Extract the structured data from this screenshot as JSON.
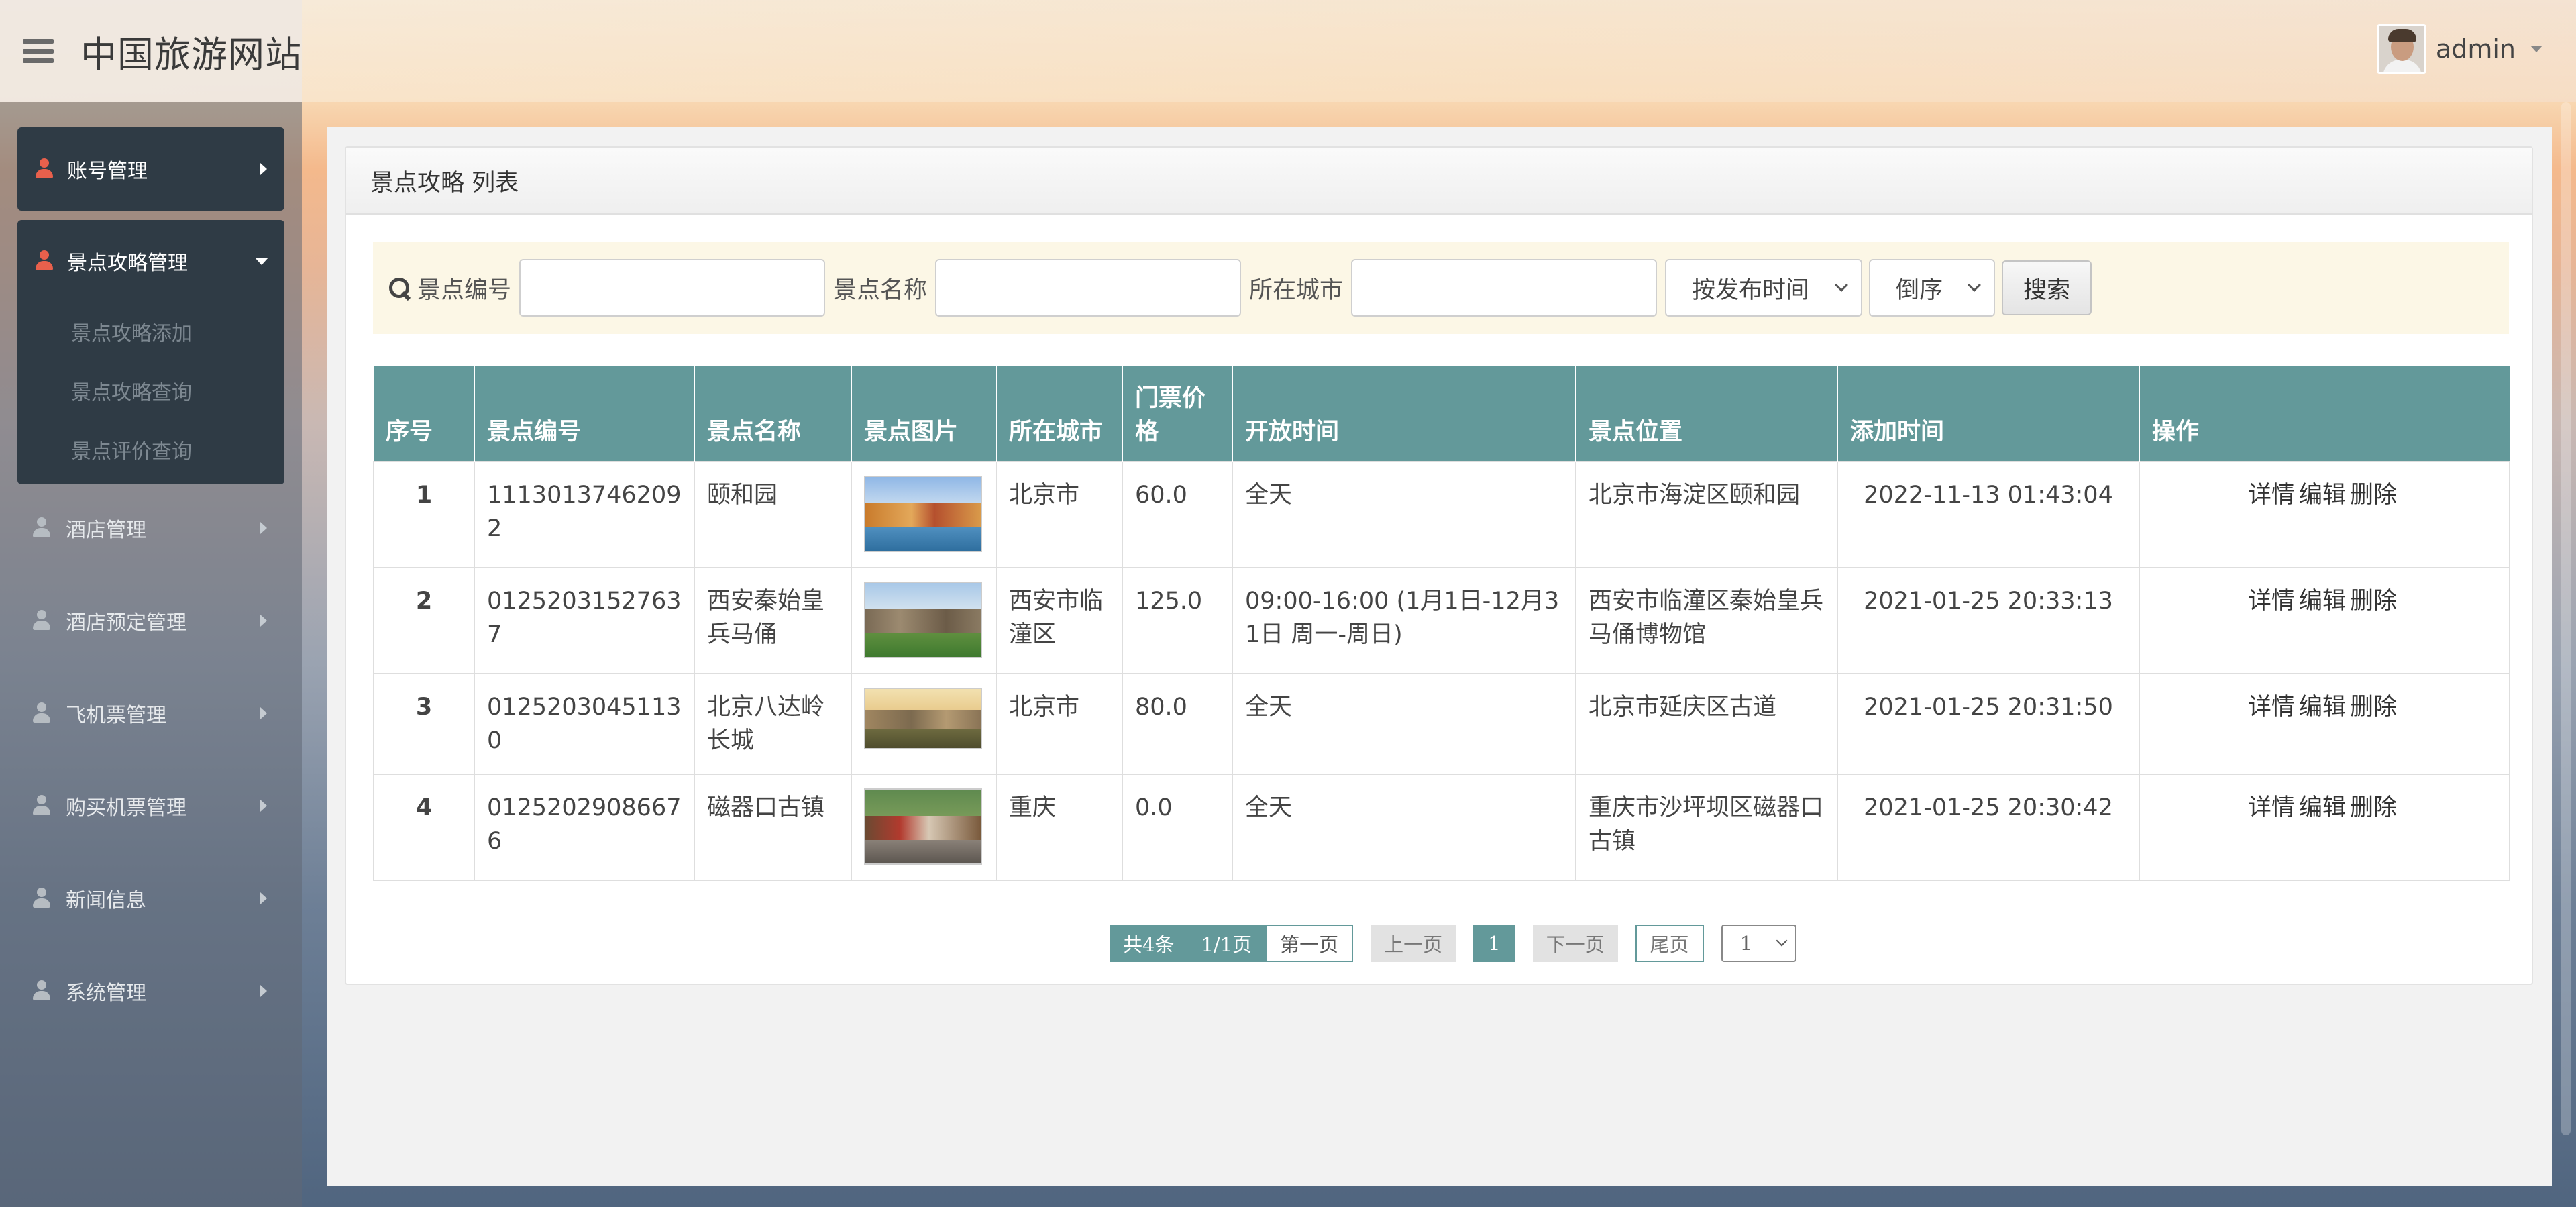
{
  "header": {
    "site_title": "中国旅游网站",
    "user_name": "admin"
  },
  "sidebar": {
    "items": [
      {
        "label": "账号管理",
        "expanded": false,
        "active": true
      },
      {
        "label": "景点攻略管理",
        "expanded": true,
        "active": true,
        "children": [
          "景点攻略添加",
          "景点攻略查询",
          "景点评价查询"
        ]
      },
      {
        "label": "酒店管理",
        "expanded": false,
        "active": false
      },
      {
        "label": "酒店预定管理",
        "expanded": false,
        "active": false
      },
      {
        "label": "飞机票管理",
        "expanded": false,
        "active": false
      },
      {
        "label": "购买机票管理",
        "expanded": false,
        "active": false
      },
      {
        "label": "新闻信息",
        "expanded": false,
        "active": false
      },
      {
        "label": "系统管理",
        "expanded": false,
        "active": false
      }
    ]
  },
  "panel": {
    "title": "景点攻略 列表"
  },
  "search": {
    "code_label": "景点编号",
    "code_value": "",
    "name_label": "景点名称",
    "name_value": "",
    "city_label": "所在城市",
    "city_value": "",
    "sort_field": "按发布时间",
    "sort_order": "倒序",
    "search_button": "搜索"
  },
  "table": {
    "headers": [
      "序号",
      "景点编号",
      "景点名称",
      "景点图片",
      "所在城市",
      "门票价格",
      "开放时间",
      "景点位置",
      "添加时间",
      "操作"
    ],
    "rows": [
      {
        "idx": "1",
        "code": "11130137462092",
        "name": "颐和园",
        "image": "summer-palace-photo",
        "city": "北京市",
        "price": "60.0",
        "hours": "全天",
        "location": "北京市海淀区颐和园",
        "added": "2022-11-13 01:43:04"
      },
      {
        "idx": "2",
        "code": "01252031527637",
        "name": "西安秦始皇兵马俑",
        "image": "terracotta-museum-photo",
        "city": "西安市临潼区",
        "price": "125.0",
        "hours": "09:00-16:00 (1月1日-12月31日 周一-周日)",
        "location": "西安市临潼区秦始皇兵马俑博物馆",
        "added": "2021-01-25 20:33:13"
      },
      {
        "idx": "3",
        "code": "01252030451130",
        "name": "北京八达岭长城",
        "image": "great-wall-photo",
        "city": "北京市",
        "price": "80.0",
        "hours": "全天",
        "location": "北京市延庆区古道",
        "added": "2021-01-25 20:31:50"
      },
      {
        "idx": "4",
        "code": "01252029086676",
        "name": "磁器口古镇",
        "image": "ciqikou-street-photo",
        "city": "重庆",
        "price": "0.0",
        "hours": "全天",
        "location": "重庆市沙坪坝区磁器口古镇",
        "added": "2021-01-25 20:30:42"
      }
    ],
    "ops": {
      "detail": "详情",
      "edit": "编辑",
      "delete": "删除"
    }
  },
  "pagination": {
    "total": "共4条",
    "pages": "1/1页",
    "first": "第一页",
    "prev": "上一页",
    "current": "1",
    "next": "下一页",
    "last": "尾页",
    "jump_value": "1"
  },
  "colors": {
    "accent": "#63999a",
    "sidebar_active": "#2f3b45",
    "user_icon_active": "#e8604c"
  }
}
